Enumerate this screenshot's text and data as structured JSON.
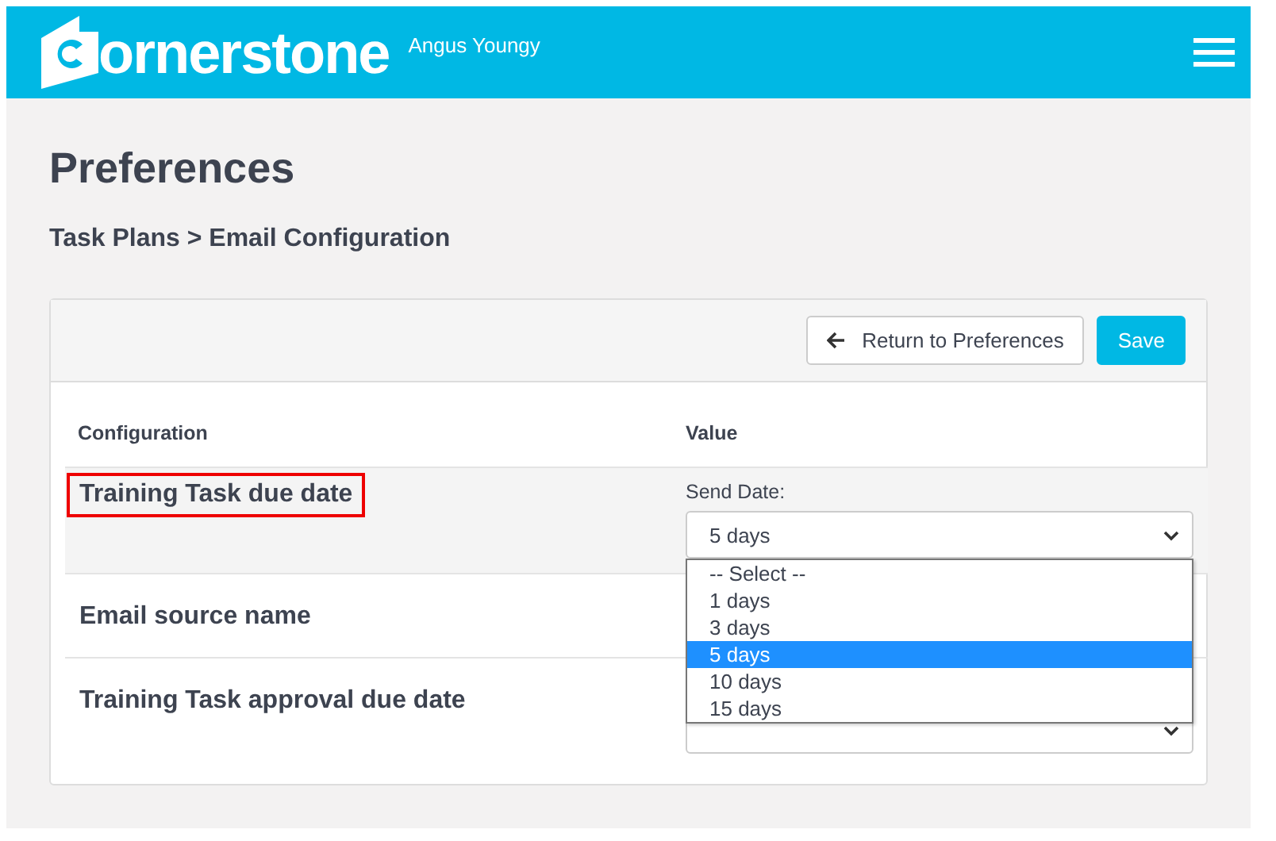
{
  "header": {
    "logo_text": "ornerstone",
    "user_name": "Angus Youngy"
  },
  "page_title": "Preferences",
  "breadcrumb": "Task Plans > Email Configuration",
  "toolbar": {
    "return_button": "Return to Preferences",
    "save_button": "Save"
  },
  "table": {
    "columns": [
      "Configuration",
      "Value"
    ],
    "rows": [
      {
        "label": "Training Task due date",
        "selected": true,
        "highlighted": true,
        "kind": "select",
        "field_label": "Send Date:",
        "value": "5 days",
        "expanded": true,
        "options": [
          {
            "label": "-- Select --",
            "selected": false
          },
          {
            "label": "1 days",
            "selected": false
          },
          {
            "label": "3 days",
            "selected": false
          },
          {
            "label": "5 days",
            "selected": true
          },
          {
            "label": "10 days",
            "selected": false
          },
          {
            "label": "15 days",
            "selected": false
          }
        ]
      },
      {
        "label": "Email source name",
        "selected": false,
        "highlighted": false
      },
      {
        "label": "Training Task approval due date",
        "selected": false,
        "highlighted": false,
        "kind": "select"
      }
    ]
  }
}
